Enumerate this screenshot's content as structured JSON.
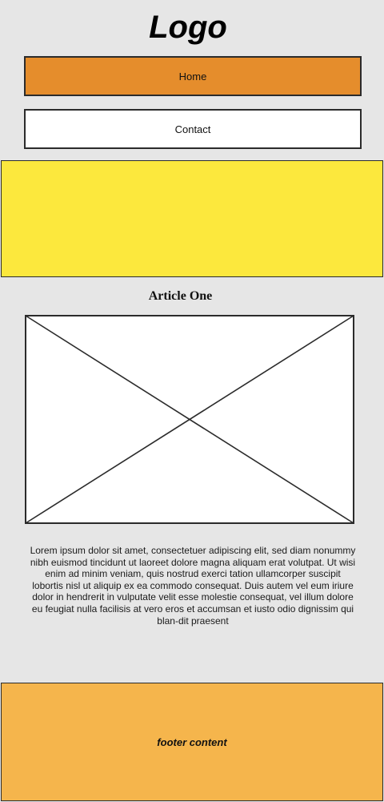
{
  "header": {
    "logo_text": "Logo"
  },
  "nav": {
    "items": [
      {
        "label": "Home",
        "active": true
      },
      {
        "label": "Contact",
        "active": false
      }
    ]
  },
  "hero": {},
  "article": {
    "title": "Article One",
    "image_icon": "image-placeholder-icon",
    "body": "Lorem ipsum dolor sit amet, consectetuer adipiscing elit, sed diam nonummy nibh euismod tincidunt ut laoreet dolore magna aliquam erat volutpat. Ut wisi enim ad minim veniam, quis nostrud exerci tation ullamcorper suscipit lobortis nisl ut aliquip ex ea commodo consequat. Duis autem vel eum iriure dolor in hendrerit in vulputate velit esse molestie consequat, vel illum dolore eu feugiat nulla facilisis at vero eros et accumsan et iusto odio dignissim qui blan-dit praesent"
  },
  "footer": {
    "text": "footer content"
  },
  "colors": {
    "background": "#e6e6e6",
    "nav_active": "#e58d2c",
    "nav_inactive": "#ffffff",
    "hero": "#fce83d",
    "footer": "#f5b54c",
    "border": "#2b2b2b"
  }
}
